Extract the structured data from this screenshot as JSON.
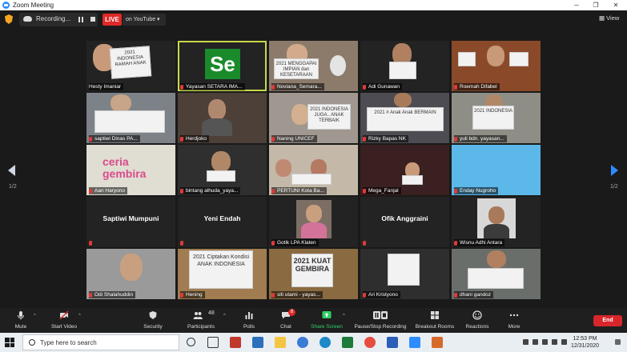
{
  "window": {
    "title": "Zoom Meeting"
  },
  "topbar": {
    "recording_label": "Recording...",
    "live_label": "LIVE",
    "stream_label": "on YouTube ▾",
    "view_label": "View"
  },
  "participants": [
    {
      "name": "Hesty Imaniar",
      "bg": "#6b4c3a"
    },
    {
      "name": "Yayasan SETARA IMA...",
      "bg": "#222222"
    },
    {
      "name": "Noviana_Semara...",
      "bg": "#8c7b6b"
    },
    {
      "name": "Adi Gunawan",
      "bg": "#5a4b40"
    },
    {
      "name": "Roemah Difabel",
      "bg": "#8a4a2a"
    },
    {
      "name": "saptiwi Dinas PA...",
      "bg": "#7c8287"
    },
    {
      "name": "Herdjoko",
      "bg": "#4d4038"
    },
    {
      "name": "Naning UNICEF",
      "bg": "#a09890"
    },
    {
      "name": "Rizky Bapas NK",
      "bg": "#4c4c52"
    },
    {
      "name": "yuli bdn. yayasan...",
      "bg": "#8e8e86"
    },
    {
      "name": "Aan Haryono",
      "bg": "#e0ddd3"
    },
    {
      "name": "bintang alhuda_yaya...",
      "bg": "#2f2f2f"
    },
    {
      "name": "PERTUNI Kota Ba...",
      "bg": "#c4b9a8"
    },
    {
      "name": "Mega_Fanjal",
      "bg": "#3a2020"
    },
    {
      "name": "Enday Nugroho",
      "bg": "#5bb8e8"
    },
    {
      "name": "Saptiwi Mumpuni",
      "bg": "#232323",
      "name_only": true
    },
    {
      "name": "Yeni Endah",
      "bg": "#232323",
      "name_only": true
    },
    {
      "name": "Gotik LPA Klaten",
      "bg": "#2a2a2a"
    },
    {
      "name": "Ofik Anggraini",
      "bg": "#232323",
      "name_only": true
    },
    {
      "name": "Wisnu Adhi Antara",
      "bg": "#3b3b3b"
    },
    {
      "name": "Odi Shalahuddin",
      "bg": "#9a9a9a"
    },
    {
      "name": "Hening",
      "bg": "#a07c50"
    },
    {
      "name": "siti utami - yayas...",
      "bg": "#8a6a40"
    },
    {
      "name": "Ari Kristyono",
      "bg": "#2e2e2e"
    },
    {
      "name": "dhani gandoz",
      "bg": "#6a6e6a"
    }
  ],
  "sign_texts": {
    "hesty": "2021 INDONESIA RAMAH ANAK",
    "yayasan_logo": "Se",
    "noviana": "2021 MENGGAPAI IMPIAN dan KESETARAAN",
    "naning": "2021 INDONESIA JUGA.. ANAK TERBAIK",
    "rizky": "2021 # Anak Anak BERMAIN",
    "yuli": "2021 INDONESIA",
    "aan": "ceria gembira",
    "hening": "2021 Ciptakan Kondisi ANAK INDONESIA",
    "siti": "2021 KUAT GEMBIRA"
  },
  "pagination": {
    "left": "1/2",
    "right": "1/2"
  },
  "toolbar": {
    "mute": "Mute",
    "start_video": "Start Video",
    "security": "Security",
    "participants": "Participants",
    "participants_count": "48",
    "polls": "Polls",
    "chat": "Chat",
    "chat_badge": "8",
    "share_screen": "Share Screen",
    "pause_stop": "Pause/Stop Recording",
    "breakout": "Breakout Rooms",
    "reactions": "Reactions",
    "more": "More",
    "end": "End"
  },
  "taskbar": {
    "search_placeholder": "Type here to search",
    "time": "12:53 PM",
    "date": "12/31/2020"
  },
  "colors": {
    "zoom_blue": "#2d8cff",
    "live_red": "#e02828",
    "active_speaker": "#c9d94a",
    "share_green": "#2fd066",
    "end_red": "#d8262b"
  }
}
